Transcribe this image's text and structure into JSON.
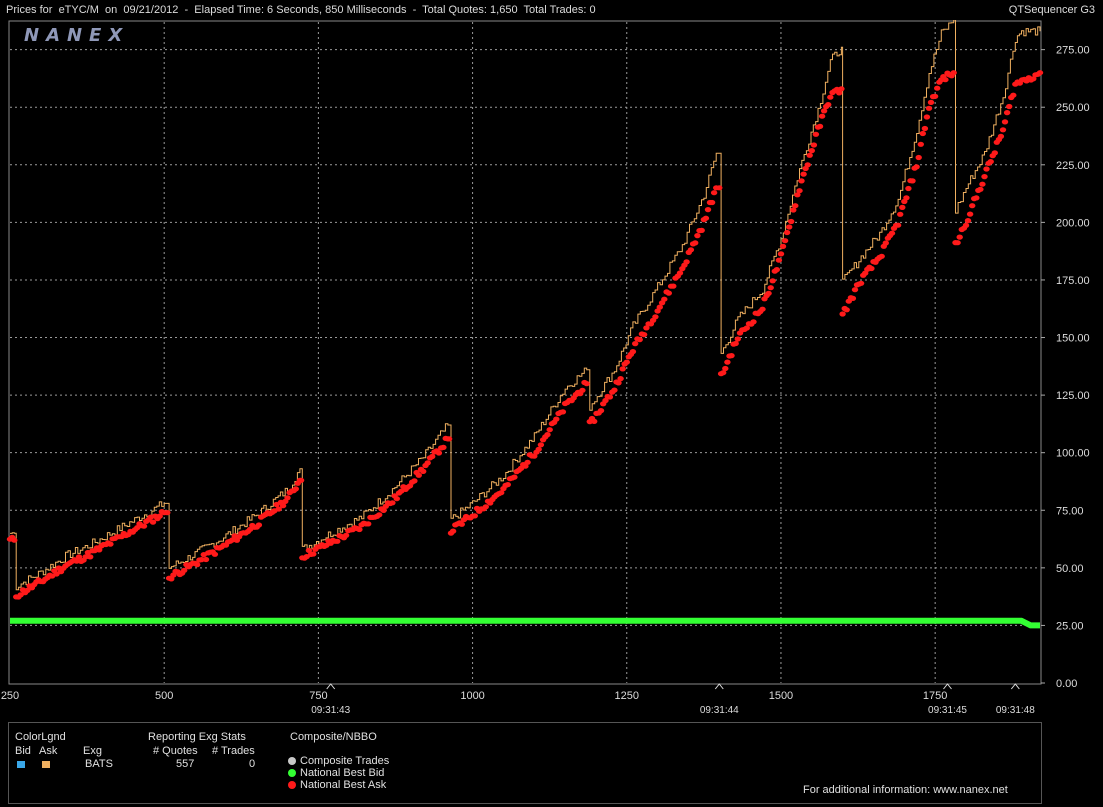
{
  "window": {
    "title": "Prices for  eTYC/M  on  09/21/2012  -  Elapsed Time: 6 Seconds, 850 Milliseconds  -  Total Quotes: 1,650  Total Trades: 0",
    "app_name": "QTSequencer G3"
  },
  "logo_text": "NANEX",
  "legend": {
    "color_legend_title": "ColorLgnd",
    "bid_label": "Bid",
    "ask_label": "Ask",
    "bid_color": "#3aa7e8",
    "ask_color": "#f0b060",
    "exg_stats_title": "Reporting Exg Stats",
    "col_exchange": "Exg",
    "col_quotes": "# Quotes",
    "col_trades": "# Trades",
    "exchange": "BATS",
    "quotes": "557",
    "trades": "0",
    "composite_title": "Composite/NBBO",
    "items": [
      {
        "label": "Composite Trades",
        "color": "#c8c8c8"
      },
      {
        "label": "National Best Bid",
        "color": "#33ff33"
      },
      {
        "label": "National Best Ask",
        "color": "#ff1a1a"
      }
    ],
    "footer": "For additional information: www.nanex.net"
  },
  "chart_data": {
    "type": "line",
    "xlim": [
      250,
      1920
    ],
    "ylim": [
      0,
      287
    ],
    "y_ticks": [
      "0.00",
      "25.00",
      "50.00",
      "75.00",
      "100.00",
      "125.00",
      "150.00",
      "175.00",
      "200.00",
      "225.00",
      "250.00",
      "275.00"
    ],
    "x_ticks": [
      "250",
      "500",
      "750",
      "1000",
      "1250",
      "1500",
      "1750"
    ],
    "time_labels": [
      {
        "x": 770,
        "label": "09:31:43"
      },
      {
        "x": 1400,
        "label": "09:31:44"
      },
      {
        "x": 1770,
        "label": "09:31:45"
      },
      {
        "x": 1880,
        "label": "09:31:48"
      }
    ],
    "grid": true,
    "series": [
      {
        "name": "National Best Ask",
        "color": "#ff1a1a",
        "style": "dots",
        "points": [
          [
            250,
            62
          ],
          [
            257,
            62
          ],
          [
            260,
            38
          ],
          [
            300,
            44
          ],
          [
            340,
            51
          ],
          [
            380,
            56
          ],
          [
            420,
            62
          ],
          [
            460,
            68
          ],
          [
            500,
            74
          ],
          [
            505,
            74
          ],
          [
            508,
            46
          ],
          [
            550,
            52
          ],
          [
            600,
            60
          ],
          [
            650,
            69
          ],
          [
            700,
            80
          ],
          [
            720,
            88
          ],
          [
            722,
            88
          ],
          [
            724,
            55
          ],
          [
            770,
            61
          ],
          [
            820,
            68
          ],
          [
            870,
            79
          ],
          [
            920,
            93
          ],
          [
            960,
            106
          ],
          [
            962,
            106
          ],
          [
            965,
            66
          ],
          [
            1000,
            73
          ],
          [
            1050,
            84
          ],
          [
            1100,
            100
          ],
          [
            1150,
            120
          ],
          [
            1185,
            130
          ],
          [
            1190,
            112
          ],
          [
            1230,
            128
          ],
          [
            1260,
            145
          ],
          [
            1300,
            162
          ],
          [
            1340,
            180
          ],
          [
            1375,
            200
          ],
          [
            1395,
            215
          ],
          [
            1400,
            215
          ],
          [
            1403,
            133
          ],
          [
            1430,
            150
          ],
          [
            1470,
            163
          ],
          [
            1500,
            185
          ],
          [
            1530,
            215
          ],
          [
            1560,
            240
          ],
          [
            1580,
            255
          ],
          [
            1598,
            258
          ],
          [
            1600,
            160
          ],
          [
            1630,
            175
          ],
          [
            1660,
            185
          ],
          [
            1690,
            200
          ],
          [
            1720,
            225
          ],
          [
            1740,
            250
          ],
          [
            1760,
            262
          ],
          [
            1780,
            265
          ],
          [
            1783,
            190
          ],
          [
            1800,
            200
          ],
          [
            1830,
            220
          ],
          [
            1860,
            240
          ],
          [
            1880,
            260
          ],
          [
            1920,
            265
          ]
        ]
      },
      {
        "name": "Ask Quotes",
        "color": "#f0b060",
        "style": "step",
        "points": [
          [
            250,
            65
          ],
          [
            257,
            65
          ],
          [
            260,
            42
          ],
          [
            300,
            48
          ],
          [
            340,
            55
          ],
          [
            380,
            60
          ],
          [
            420,
            66
          ],
          [
            460,
            72
          ],
          [
            500,
            78
          ],
          [
            505,
            78
          ],
          [
            508,
            50
          ],
          [
            550,
            56
          ],
          [
            600,
            64
          ],
          [
            650,
            73
          ],
          [
            700,
            84
          ],
          [
            720,
            93
          ],
          [
            722,
            93
          ],
          [
            724,
            58
          ],
          [
            770,
            65
          ],
          [
            820,
            72
          ],
          [
            870,
            84
          ],
          [
            920,
            98
          ],
          [
            960,
            112
          ],
          [
            962,
            112
          ],
          [
            965,
            71
          ],
          [
            1000,
            78
          ],
          [
            1050,
            90
          ],
          [
            1100,
            107
          ],
          [
            1150,
            128
          ],
          [
            1185,
            136
          ],
          [
            1190,
            120
          ],
          [
            1230,
            136
          ],
          [
            1260,
            155
          ],
          [
            1300,
            172
          ],
          [
            1340,
            190
          ],
          [
            1375,
            212
          ],
          [
            1395,
            230
          ],
          [
            1400,
            230
          ],
          [
            1403,
            143
          ],
          [
            1430,
            158
          ],
          [
            1470,
            171
          ],
          [
            1500,
            193
          ],
          [
            1530,
            223
          ],
          [
            1560,
            249
          ],
          [
            1580,
            270
          ],
          [
            1598,
            276
          ],
          [
            1600,
            174
          ],
          [
            1630,
            185
          ],
          [
            1660,
            195
          ],
          [
            1690,
            210
          ],
          [
            1720,
            240
          ],
          [
            1740,
            265
          ],
          [
            1760,
            282
          ],
          [
            1780,
            288
          ],
          [
            1783,
            205
          ],
          [
            1800,
            215
          ],
          [
            1830,
            230
          ],
          [
            1860,
            255
          ],
          [
            1880,
            280
          ],
          [
            1890,
            283
          ],
          [
            1920,
            283
          ]
        ]
      },
      {
        "name": "National Best Bid",
        "color": "#33ff33",
        "style": "thick",
        "points": [
          [
            250,
            27
          ],
          [
            1890,
            27
          ],
          [
            1905,
            25
          ],
          [
            1920,
            25
          ]
        ]
      }
    ]
  }
}
